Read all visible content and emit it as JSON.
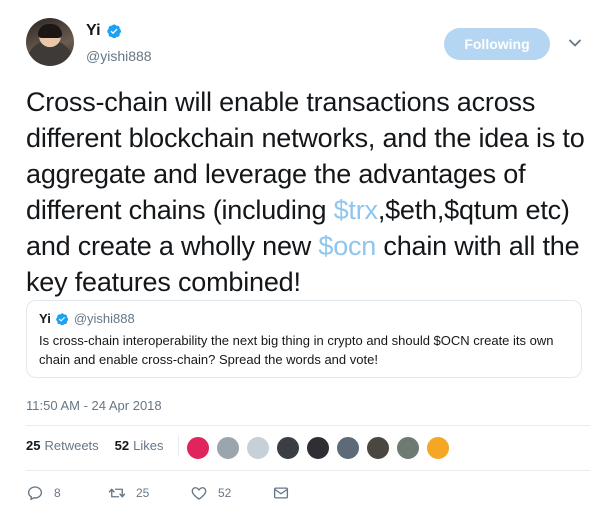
{
  "user": {
    "name": "Yi",
    "handle": "@yishi888",
    "verified_color": "#1da1f2"
  },
  "follow_button": {
    "label": "Following",
    "color": "#b4d6f2"
  },
  "tweet": {
    "text_parts": [
      "Cross-chain will enable transactions across different blockchain networks, and the idea is to aggregate and leverage the advantages of different chains (including ",
      "$trx",
      ",$eth,$qtum etc) and create a wholly new ",
      "$ocn",
      " chain with all the key features combined!"
    ],
    "cashtag_color": "#8ec6ee"
  },
  "quoted": {
    "name": "Yi",
    "handle": "@yishi888",
    "text": "Is cross-chain interoperability the next big thing in crypto and should $OCN create its own chain and enable cross-chain? Spread the words and vote!"
  },
  "timestamp": "11:50 AM - 24 Apr 2018",
  "stats": {
    "retweets_count": "25",
    "retweets_label": "Retweets",
    "likes_count": "52",
    "likes_label": "Likes"
  },
  "likers": [
    {
      "name": "liker-avatar-1",
      "color": "#e0245e"
    },
    {
      "name": "liker-avatar-2",
      "color": "#9aa5ad"
    },
    {
      "name": "liker-avatar-3",
      "color": "#c5d0d8"
    },
    {
      "name": "liker-avatar-4",
      "color": "#3b3f44"
    },
    {
      "name": "liker-avatar-5",
      "color": "#2d2f33"
    },
    {
      "name": "liker-avatar-6",
      "color": "#5d6b78"
    },
    {
      "name": "liker-avatar-7",
      "color": "#4a4640"
    },
    {
      "name": "liker-avatar-8",
      "color": "#6e7a72"
    },
    {
      "name": "liker-avatar-9",
      "color": "#f5a623"
    }
  ],
  "actions": {
    "reply_count": "8",
    "retweet_count": "25",
    "like_count": "52"
  }
}
